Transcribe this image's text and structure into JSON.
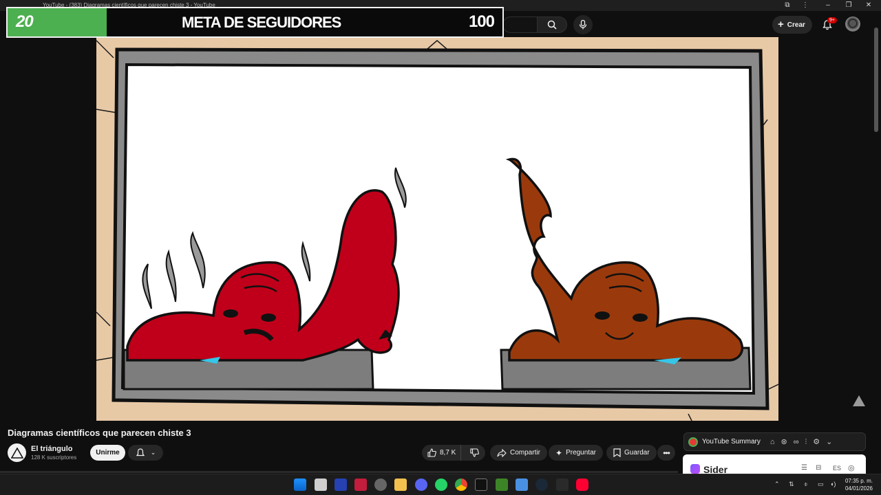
{
  "browser": {
    "tab_title": "YouTube - (383) Diagramas científicos que parecen chiste 3 - YouTube"
  },
  "header": {
    "create_label": "Crear",
    "notification_count": "9+"
  },
  "goal_overlay": {
    "current": "20",
    "title": "META DE SEGUIDORES",
    "target": "100",
    "progress_fraction": 0.2,
    "fill_color": "#4caf50"
  },
  "video": {
    "title": "Diagramas científicos que parecen chiste 3",
    "channel_name": "El triángulo",
    "subscribers": "128 K suscriptores",
    "join_label": "Unirme"
  },
  "actions": {
    "likes": "8,7 K",
    "share": "Compartir",
    "ask": "Preguntar",
    "save": "Guardar"
  },
  "extensions": {
    "summary_label": "YouTube Summary",
    "sider_label": "Sider",
    "sider_lang": "ES"
  },
  "taskbar": {
    "time": "07:35 p. m.",
    "date": "04/01/2026",
    "accent": "#0078d4"
  }
}
